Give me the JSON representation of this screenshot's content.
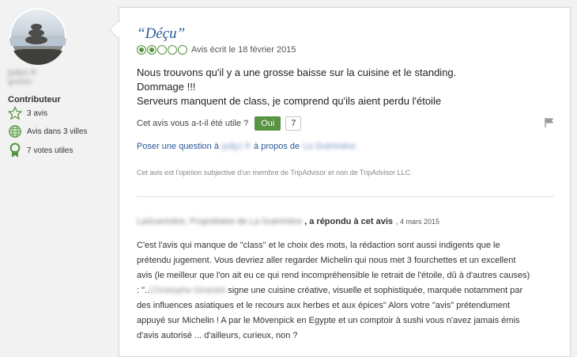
{
  "reviewer": {
    "name": "judy1 fr",
    "location": "grosso",
    "level_label": "Contributeur",
    "stats": [
      {
        "label": "3 avis",
        "icon": "star-outline-icon"
      },
      {
        "label": "Avis dans 3 villes",
        "icon": "globe-icon"
      },
      {
        "label": "7 votes utiles",
        "icon": "ribbon-badge-icon"
      }
    ]
  },
  "review": {
    "title": "“Déçu”",
    "rating": 2,
    "rating_max": 5,
    "rating_color": "#589442",
    "date_text": "Avis écrit le 18 février 2015",
    "body_lines": [
      "Nous trouvons qu'il y a une grosse baisse sur la cuisine et le standing.",
      "Dommage !!!",
      "Serveurs manquent de class, je comprend qu'ils aient perdu l'étoile"
    ],
    "helpful_question": "Cet avis vous a-t-il été utile ?",
    "helpful_button": "Oui",
    "helpful_count": "7",
    "question_prefix": "Poser une question à",
    "question_user": "judy1 fr",
    "question_mid": "à propos de",
    "question_place": "La Guérinière",
    "disclaimer": "Cet avis est l'opinion subjective d'un membre de TripAdvisor et non de TripAdvisor LLC."
  },
  "response": {
    "owner": "LaGuerinère, Propriétaire de La Guérinière",
    "label": ", a répondu à cet avis",
    "date": ", 4 mars 2015",
    "lines": [
      "C'est l'avis qui manque de \"class\" et le choix des mots, la rédaction sont aussi indigents que le",
      "prétendu jugement. Vous devriez aller regarder Michelin qui nous met 3 fourchettes et un excellent",
      "avis (le meilleur que l'on ait eu ce qui rend incompréhensible le retrait de l'étoile, dû à d'autres causes)"
    ],
    "line4_prefix": ": \"..",
    "line4_blur": "Christophe Girardot",
    "line4_rest": " signe une cuisine créative, visuelle et sophistiquée, marquée notamment par",
    "lines_after": [
      "des influences asiatiques et le recours aux herbes et aux épices\" Alors votre \"avis\" prétendument",
      "appuyé sur Michelin ! A par le Mövenpick en Egypte et un comptoir à sushi vous n'avez jamais émis",
      "d'avis autorisé ... d'ailleurs, curieux, non ?"
    ]
  }
}
